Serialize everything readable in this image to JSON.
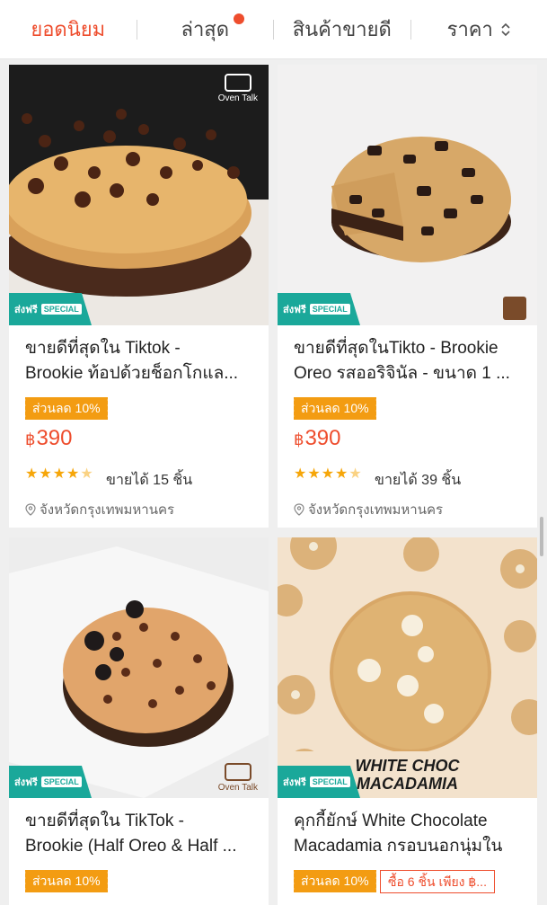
{
  "sort_bar": {
    "tabs": [
      {
        "label": "ยอดนิยม",
        "active": true
      },
      {
        "label": "ล่าสุด",
        "has_dot": true
      },
      {
        "label": "สินค้าขายดี"
      },
      {
        "label": "ราคา",
        "icon": "sort-arrows-icon"
      }
    ]
  },
  "products": [
    {
      "title_line1": "ขายดีที่สุดใน Tiktok -",
      "title_line2": "Brookie ท้อปด้วยช็อกโกแล...",
      "discount": "ส่วนลด 10%",
      "currency": "฿",
      "price": "390",
      "rating": 4.5,
      "sold": "ขายได้ 15 ชิ้น",
      "location": "จังหวัดกรุงเทพมหานคร",
      "shipping_badge": "ส่งฟรี",
      "badge_special": "SPECIAL",
      "brand": "Oven Talk"
    },
    {
      "title_line1": "ขายดีที่สุดในTikto - Brookie",
      "title_line2": "Oreo รสออริจินัล - ขนาด 1 ...",
      "discount": "ส่วนลด 10%",
      "currency": "฿",
      "price": "390",
      "rating": 4.5,
      "sold": "ขายได้ 39 ชิ้น",
      "location": "จังหวัดกรุงเทพมหานคร",
      "shipping_badge": "ส่งฟรี",
      "badge_special": "SPECIAL"
    },
    {
      "title_line1": "ขายดีที่สุดใน TikTok -",
      "title_line2": "Brookie (Half Oreo & Half ...",
      "discount": "ส่วนลด 10%",
      "shipping_badge": "ส่งฟรี",
      "badge_special": "SPECIAL",
      "brand": "Oven Talk"
    },
    {
      "title_line1": "คุกกี้ยักษ์ White Chocolate",
      "title_line2": "Macadamia กรอบนอกนุ่มใน",
      "discount": "ส่วนลด 10%",
      "promo": "ซื้อ 6 ชิ้น เพียง ฿...",
      "image_text_line1": "WHITE CHOC",
      "image_text_line2": "MACADAMIA",
      "shipping_badge": "ส่งฟรี",
      "badge_special": "SPECIAL"
    }
  ],
  "colors": {
    "accent": "#ee4d2d",
    "discount_tag": "#f39c12",
    "stars": "#f6a609",
    "shipping_badge": "#1aa89a"
  }
}
